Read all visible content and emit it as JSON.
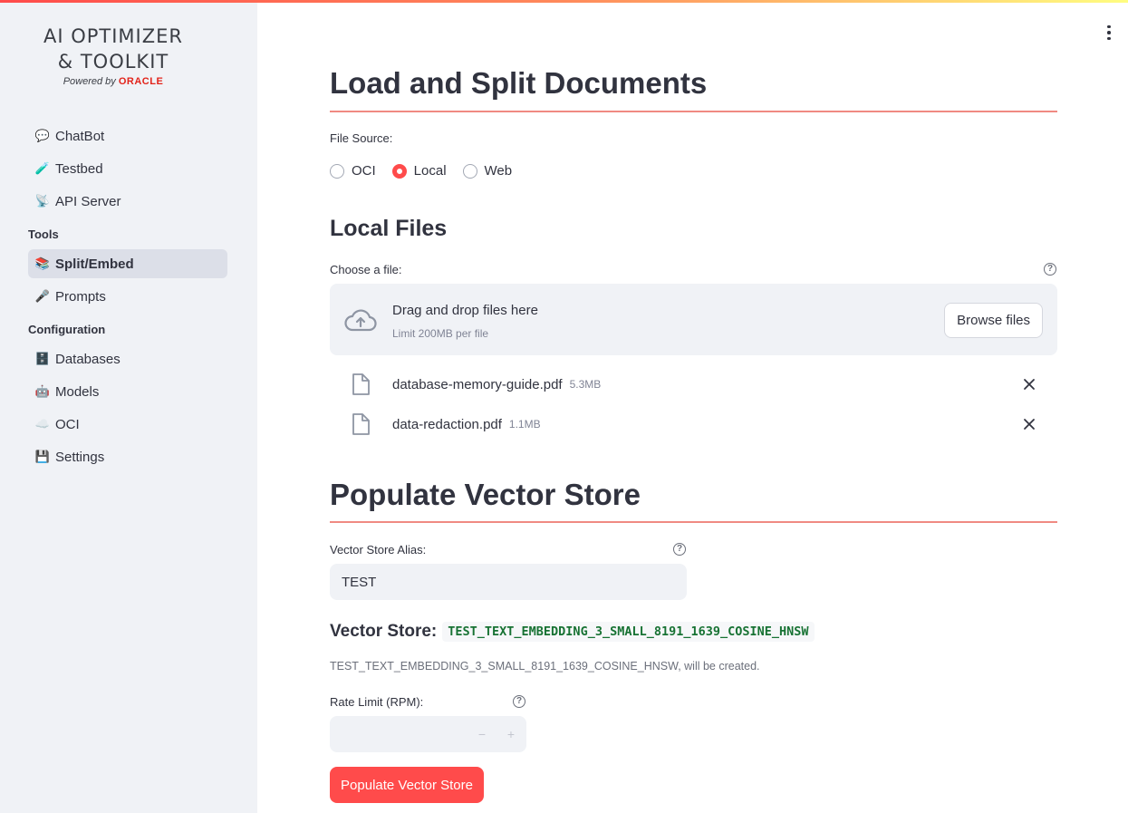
{
  "sidebar": {
    "logo": {
      "line1": "AI OPTIMIZER",
      "line2": "& TOOLKIT",
      "powered_by": "Powered by",
      "brand": "ORACLE"
    },
    "items": [
      {
        "icon": "speech-bubble-icon",
        "emoji": "💬",
        "label": "ChatBot"
      },
      {
        "icon": "test-tube-icon",
        "emoji": "🧪",
        "label": "Testbed"
      },
      {
        "icon": "satellite-dish-icon",
        "emoji": "📡",
        "label": "API Server"
      }
    ],
    "tools_heading": "Tools",
    "tools": [
      {
        "icon": "books-icon",
        "emoji": "📚",
        "label": "Split/Embed",
        "active": true
      },
      {
        "icon": "microphone-icon",
        "emoji": "🎤",
        "label": "Prompts"
      }
    ],
    "config_heading": "Configuration",
    "config": [
      {
        "icon": "file-cabinet-icon",
        "emoji": "🗄️",
        "label": "Databases"
      },
      {
        "icon": "robot-icon",
        "emoji": "🤖",
        "label": "Models"
      },
      {
        "icon": "cloud-icon",
        "emoji": "☁️",
        "label": "OCI"
      },
      {
        "icon": "floppy-disk-icon",
        "emoji": "💾",
        "label": "Settings"
      }
    ]
  },
  "main": {
    "title": "Load and Split Documents",
    "file_source_label": "File Source:",
    "file_source_options": [
      "OCI",
      "Local",
      "Web"
    ],
    "file_source_selected": "Local",
    "local_files_heading": "Local Files",
    "choose_file_label": "Choose a file:",
    "dropzone": {
      "title": "Drag and drop files here",
      "subtitle": "Limit 200MB per file",
      "browse_label": "Browse files"
    },
    "files": [
      {
        "name": "database-memory-guide.pdf",
        "size": "5.3MB"
      },
      {
        "name": "data-redaction.pdf",
        "size": "1.1MB"
      }
    ],
    "populate_heading": "Populate Vector Store",
    "alias_label": "Vector Store Alias:",
    "alias_value": "TEST",
    "vector_store_label": "Vector Store:",
    "vector_store_name": "TEST_TEXT_EMBEDDING_3_SMALL_8191_1639_COSINE_HNSW",
    "vector_store_note": "TEST_TEXT_EMBEDDING_3_SMALL_8191_1639_COSINE_HNSW, will be created.",
    "rate_limit_label": "Rate Limit (RPM):",
    "rate_limit_value": "",
    "stepper_minus": "−",
    "stepper_plus": "+",
    "populate_button": "Populate Vector Store"
  },
  "colors": {
    "accent": "#ff4b4b",
    "sidebar_bg": "#f0f2f6",
    "rule": "#f08a82",
    "code_green": "#177233"
  }
}
